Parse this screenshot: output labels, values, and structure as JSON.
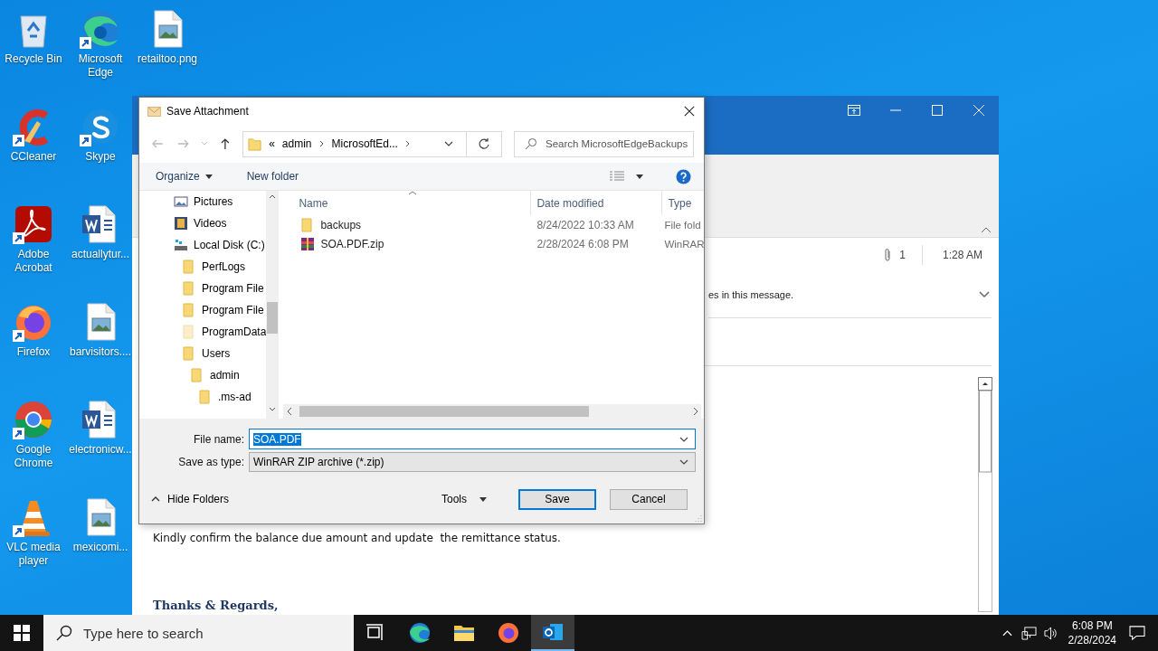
{
  "desktop_icons": [
    {
      "label": "Recycle Bin",
      "kind": "recycle",
      "shortcut": false
    },
    {
      "label": "CCleaner",
      "kind": "ccleaner",
      "shortcut": true
    },
    {
      "label": "Adobe Acrobat",
      "kind": "acrobat",
      "shortcut": true
    },
    {
      "label": "Firefox",
      "kind": "firefox",
      "shortcut": true
    },
    {
      "label": "Google Chrome",
      "kind": "chrome",
      "shortcut": true
    },
    {
      "label": "VLC media player",
      "kind": "vlc",
      "shortcut": true
    },
    {
      "label": "Microsoft Edge",
      "kind": "edge",
      "shortcut": true
    },
    {
      "label": "Skype",
      "kind": "skype",
      "shortcut": true
    },
    {
      "label": "actuallytur...",
      "kind": "word",
      "shortcut": false
    },
    {
      "label": "barvisitors....",
      "kind": "image",
      "shortcut": false
    },
    {
      "label": "electronicw...",
      "kind": "word",
      "shortcut": false
    },
    {
      "label": "mexicomi...",
      "kind": "image",
      "shortcut": false
    },
    {
      "label": "retailtoo.png",
      "kind": "image",
      "shortcut": false
    }
  ],
  "mail_window": {
    "attachment_count": "1",
    "received_time": "1:28 AM",
    "info_bar": "es in this message.",
    "body": "Kindly confirm the balance due amount and update  the remittance status.",
    "signature": "Thanks & Regards,"
  },
  "dialog": {
    "title": "Save Attachment",
    "address": {
      "overflow": "«",
      "parts": [
        "admin",
        "MicrosoftEd..."
      ]
    },
    "search": {
      "placeholder": "Search MicrosoftEdgeBackups"
    },
    "toolbar": [
      {
        "label": "Organize",
        "dropdown": true
      },
      {
        "label": "New folder",
        "dropdown": false
      }
    ],
    "folder_tree": [
      {
        "label": "Pictures",
        "kind": "pictures"
      },
      {
        "label": "Videos",
        "kind": "videos"
      },
      {
        "label": "Local Disk (C:)",
        "kind": "drive",
        "children": [
          {
            "label": "PerfLogs",
            "kind": "folder"
          },
          {
            "label": "Program File",
            "kind": "folder"
          },
          {
            "label": "Program File",
            "kind": "folder"
          },
          {
            "label": "ProgramData",
            "kind": "hidden-folder"
          },
          {
            "label": "Users",
            "kind": "folder",
            "children": [
              {
                "label": "admin",
                "kind": "folder",
                "children": [
                  {
                    "label": ".ms-ad",
                    "kind": "folder"
                  }
                ]
              }
            ]
          }
        ]
      }
    ],
    "columns": [
      "Name",
      "Date modified",
      "Type"
    ],
    "files": [
      {
        "name": "backups",
        "kind": "folder",
        "date": "8/24/2022 10:33 AM",
        "type": "File fold"
      },
      {
        "name": "SOA.PDF.zip",
        "kind": "archive",
        "date": "2/28/2024 6:08 PM",
        "type": "WinRAR"
      }
    ],
    "file_name": {
      "label": "File name:",
      "value": "SOA.PDF",
      "text_selected": true
    },
    "save_type": {
      "label": "Save as type:",
      "value": "WinRAR ZIP archive (*.zip)"
    },
    "hide_folders": "Hide Folders",
    "tools": "Tools",
    "buttons": [
      {
        "label": "Save",
        "default": true
      },
      {
        "label": "Cancel",
        "default": false
      }
    ]
  },
  "taskbar": {
    "search": {
      "placeholder": "Type here to search"
    },
    "apps": [
      {
        "kind": "task-view",
        "selected": false
      },
      {
        "kind": "edge",
        "selected": false
      },
      {
        "kind": "explorer",
        "selected": false
      },
      {
        "kind": "firefox",
        "selected": false
      },
      {
        "kind": "outlook",
        "selected": true
      }
    ],
    "time": "6:08 PM",
    "date": "2/28/2024"
  }
}
